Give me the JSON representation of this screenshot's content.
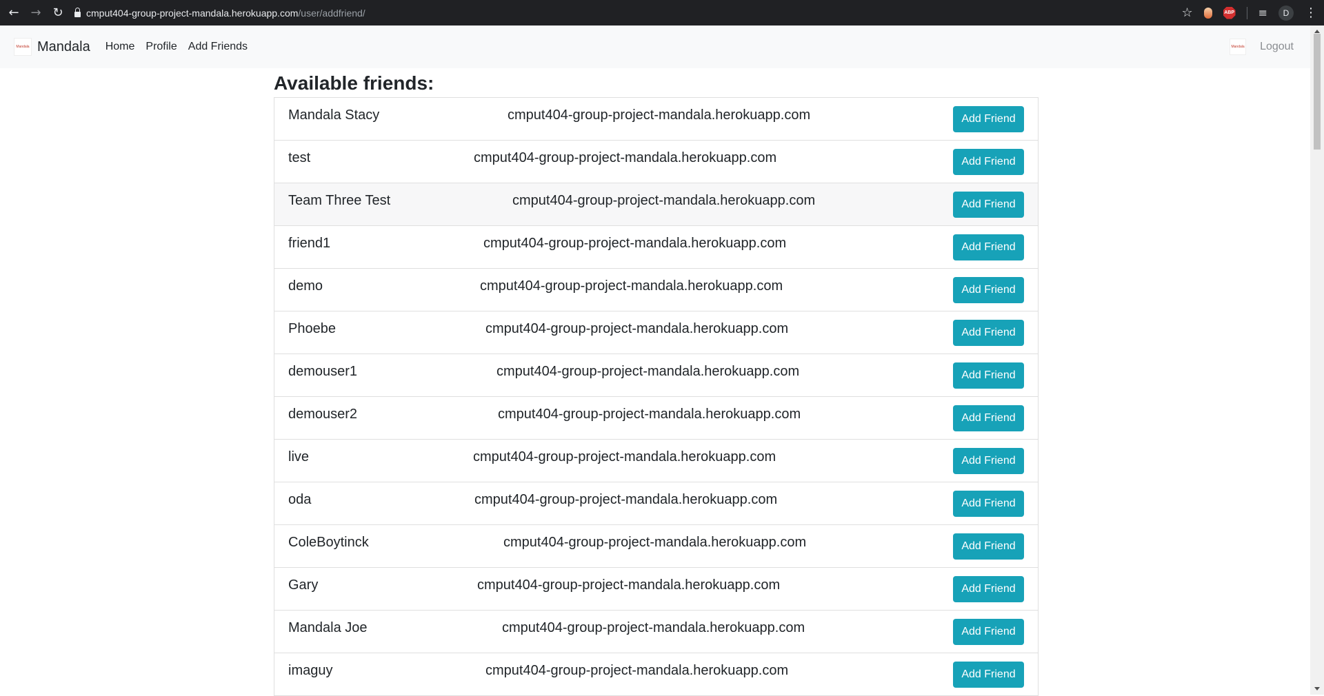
{
  "browser": {
    "host": "cmput404-group-project-mandala.herokuapp.com",
    "path": "/user/addfriend/",
    "avatar_initial": "D",
    "abp_label": "ABP"
  },
  "navbar": {
    "brand": "Mandala",
    "logo_text": "Mandala",
    "links": [
      "Home",
      "Profile",
      "Add Friends"
    ],
    "logout": "Logout"
  },
  "page": {
    "title": "Available friends:",
    "button_label": "Add Friend"
  },
  "friends": [
    {
      "name": "Mandala Stacy",
      "host": "cmput404-group-project-mandala.herokuapp.com"
    },
    {
      "name": "test",
      "host": "cmput404-group-project-mandala.herokuapp.com"
    },
    {
      "name": "Team Three Test",
      "host": "cmput404-group-project-mandala.herokuapp.com"
    },
    {
      "name": "friend1",
      "host": "cmput404-group-project-mandala.herokuapp.com"
    },
    {
      "name": "demo",
      "host": "cmput404-group-project-mandala.herokuapp.com"
    },
    {
      "name": "Phoebe",
      "host": "cmput404-group-project-mandala.herokuapp.com"
    },
    {
      "name": "demouser1",
      "host": "cmput404-group-project-mandala.herokuapp.com"
    },
    {
      "name": "demouser2",
      "host": "cmput404-group-project-mandala.herokuapp.com"
    },
    {
      "name": "live",
      "host": "cmput404-group-project-mandala.herokuapp.com"
    },
    {
      "name": "oda",
      "host": "cmput404-group-project-mandala.herokuapp.com"
    },
    {
      "name": "ColeBoytinck",
      "host": "cmput404-group-project-mandala.herokuapp.com"
    },
    {
      "name": "Gary",
      "host": "cmput404-group-project-mandala.herokuapp.com"
    },
    {
      "name": "Mandala Joe",
      "host": "cmput404-group-project-mandala.herokuapp.com"
    },
    {
      "name": "imaguy",
      "host": "cmput404-group-project-mandala.herokuapp.com"
    }
  ],
  "colors": {
    "button": "#17a2b8",
    "navbar_bg": "#f8f9fa",
    "chrome_bg": "#202124"
  },
  "icons": [
    "back-arrow-icon",
    "forward-arrow-icon",
    "reload-icon",
    "lock-icon",
    "star-icon",
    "extension-icon",
    "adblock-icon",
    "media-queue-icon",
    "profile-avatar-icon",
    "kebab-menu-icon"
  ]
}
